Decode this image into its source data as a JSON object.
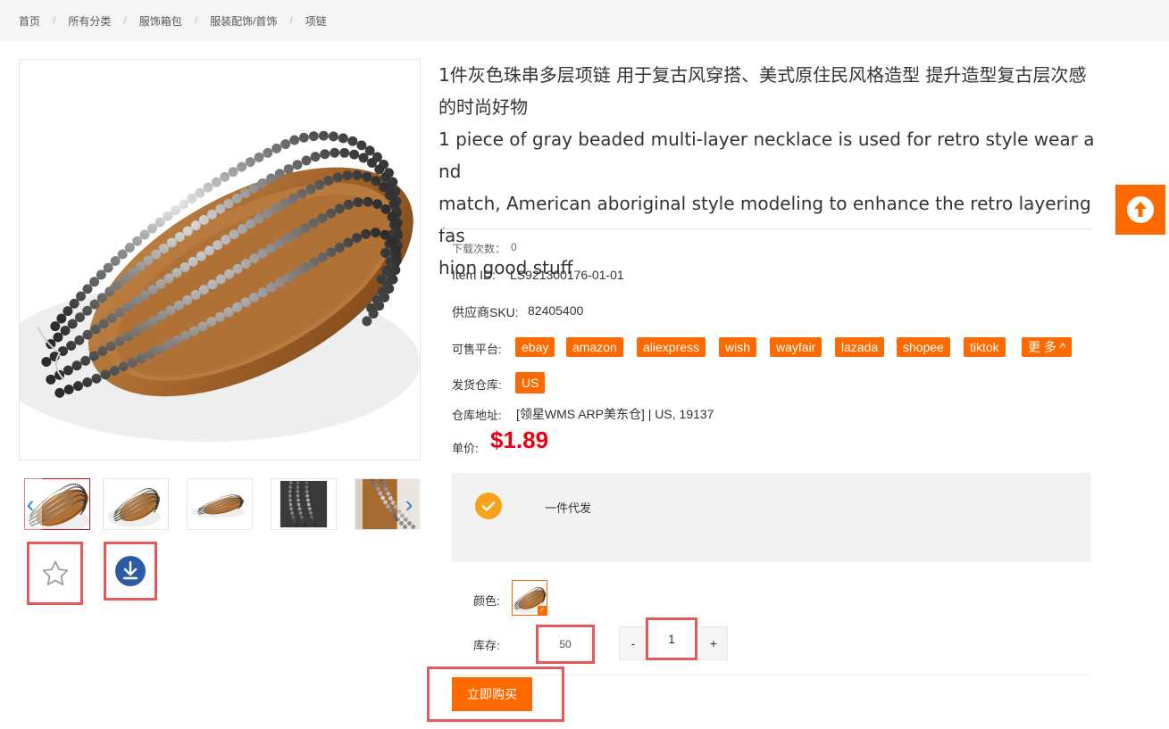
{
  "breadcrumb": {
    "items": [
      "首页",
      "所有分类",
      "服饰箱包",
      "服装配饰/首饰",
      "项链"
    ],
    "separator": "/"
  },
  "product": {
    "title_cn_1": "1件灰色珠串多层项链 用于复古风穿搭、美式原住民风格造型 提升造型复古层次感",
    "title_cn_2": "的时尚好物",
    "title_en_1": "1 piece of gray beaded multi-layer necklace is used for retro style wear and",
    "title_en_2": "match, American aboriginal style modeling to enhance the retro layering fas",
    "title_en_3": "hion good stuff"
  },
  "info": {
    "downloads_label": "下载次数：",
    "downloads_value": "0",
    "item_id_label": "Item ID:",
    "item_id_value": "LS921300176-01-01",
    "sku_label": "供应商SKU:",
    "sku_value": "82405400",
    "platforms_label": "可售平台:",
    "platforms": [
      "ebay",
      "amazon",
      "aliexpress",
      "wish",
      "wayfair",
      "lazada",
      "shopee",
      "tiktok"
    ],
    "more_label": "更 多",
    "warehouse_label": "发货仓库:",
    "warehouse_value": "US",
    "address_label": "仓库地址:",
    "address_value": "[领星WMS ARP美东仓] | US, 19137",
    "price_label": "单价:",
    "price_value": "$1.89"
  },
  "service": {
    "label": "一件代发"
  },
  "options": {
    "color_label": "颜色:",
    "stock_label": "库存:",
    "stock_value": "50",
    "qty_minus": "-",
    "qty_value": "1",
    "qty_plus": "+"
  },
  "actions": {
    "buy_label": "立即购买"
  },
  "icons": {
    "favorite": "star-icon",
    "download": "download-icon",
    "back_to_top": "arrow-up-icon",
    "check": "check-icon"
  },
  "colors": {
    "accent": "#ff6a00",
    "price": "#e60012",
    "check": "#f7a21b",
    "download": "#2b5aa6",
    "highlight": "#e35a5a"
  }
}
